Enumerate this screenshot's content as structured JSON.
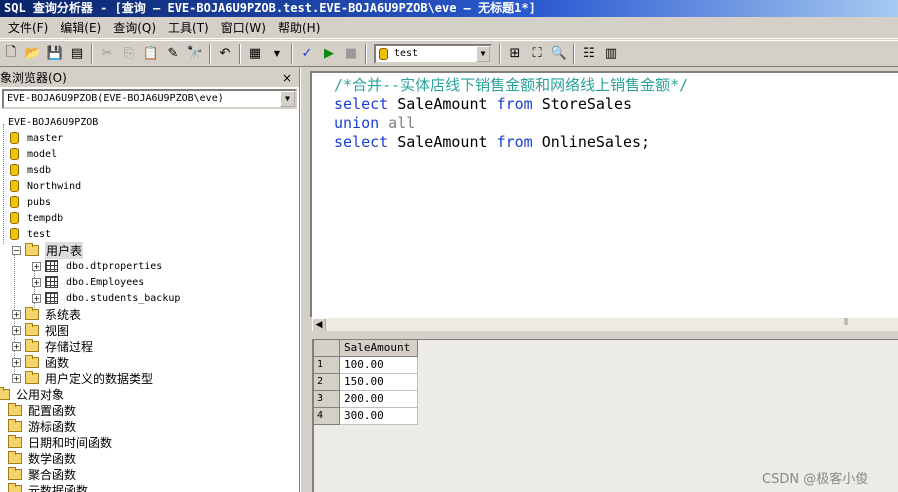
{
  "title": "SQL 查询分析器 - [查询 — EVE-BOJA6U9PZOB.test.EVE-BOJA6U9PZOB\\eve — 无标题1*]",
  "menu": [
    "文件(F)",
    "编辑(E)",
    "查询(Q)",
    "工具(T)",
    "窗口(W)",
    "帮助(H)"
  ],
  "toolbar": {
    "database": "test"
  },
  "object_browser": {
    "title": "象浏览器(O)",
    "close": "×",
    "server_combo": "EVE-BOJA6U9PZOB(EVE-BOJA6U9PZOB\\eve)",
    "server": "EVE-BOJA6U9PZOB",
    "databases": [
      "master",
      "model",
      "msdb",
      "Northwind",
      "pubs",
      "tempdb",
      "test"
    ],
    "user_tables_folder": "用户表",
    "tables": [
      "dbo.dtproperties",
      "dbo.Employees",
      "dbo.students_backup"
    ],
    "folders": [
      "系统表",
      "视图",
      "存储过程",
      "函数",
      "用户定义的数据类型"
    ],
    "common_objects": "公用对象",
    "common_items": [
      "配置函数",
      "游标函数",
      "日期和时间函数",
      "数学函数",
      "聚合函数",
      "元数据函数"
    ]
  },
  "editor": {
    "line1": "/*合并--实体店线下销售金额和网络线上销售金额*/",
    "kw_select": "select",
    "col": " SaleAmount ",
    "kw_from": "from",
    "t1": " StoreSales",
    "kw_union": "union",
    "kw_all": " all",
    "t2": " OnlineSales;"
  },
  "results": {
    "column": "SaleAmount",
    "rows": [
      {
        "n": "1",
        "v": "100.00"
      },
      {
        "n": "2",
        "v": "150.00"
      },
      {
        "n": "3",
        "v": "200.00"
      },
      {
        "n": "4",
        "v": "300.00"
      }
    ]
  },
  "watermark": "CSDN @极客小俊"
}
